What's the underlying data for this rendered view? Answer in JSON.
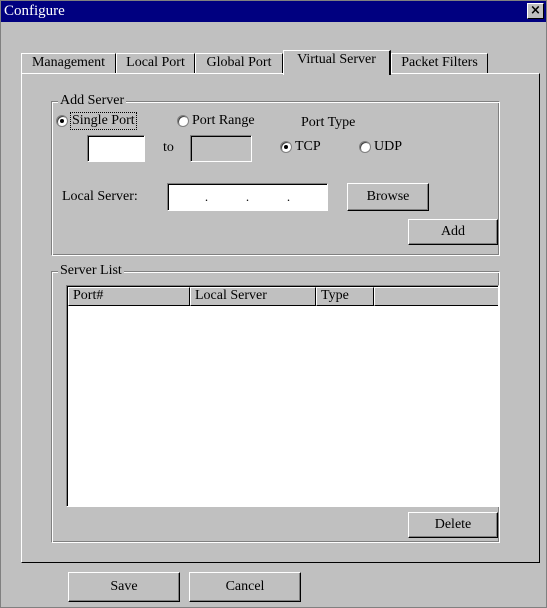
{
  "window": {
    "title": "Configure",
    "close_glyph": "×"
  },
  "tabs": [
    {
      "label": "Management",
      "active": false
    },
    {
      "label": "Local Port",
      "active": false
    },
    {
      "label": "Global Port",
      "active": false
    },
    {
      "label": "Virtual Server",
      "active": true
    },
    {
      "label": "Packet Filters",
      "active": false
    }
  ],
  "add_server": {
    "group_label": "Add Server",
    "single_port_label": "Single Port",
    "port_range_label": "Port Range",
    "selected_port_mode": "Single Port",
    "port_from_value": "",
    "to_label": "to",
    "port_to_value": "",
    "port_type_label": "Port Type",
    "tcp_label": "TCP",
    "udp_label": "UDP",
    "selected_port_type": "TCP",
    "local_server_label": "Local Server:",
    "ip_dots": [
      ".",
      ".",
      "."
    ],
    "browse_label": "Browse",
    "add_label": "Add"
  },
  "server_list": {
    "group_label": "Server List",
    "columns": [
      "Port#",
      "Local Server",
      "Type",
      ""
    ],
    "rows": [],
    "delete_label": "Delete"
  },
  "footer": {
    "save_label": "Save",
    "cancel_label": "Cancel"
  }
}
